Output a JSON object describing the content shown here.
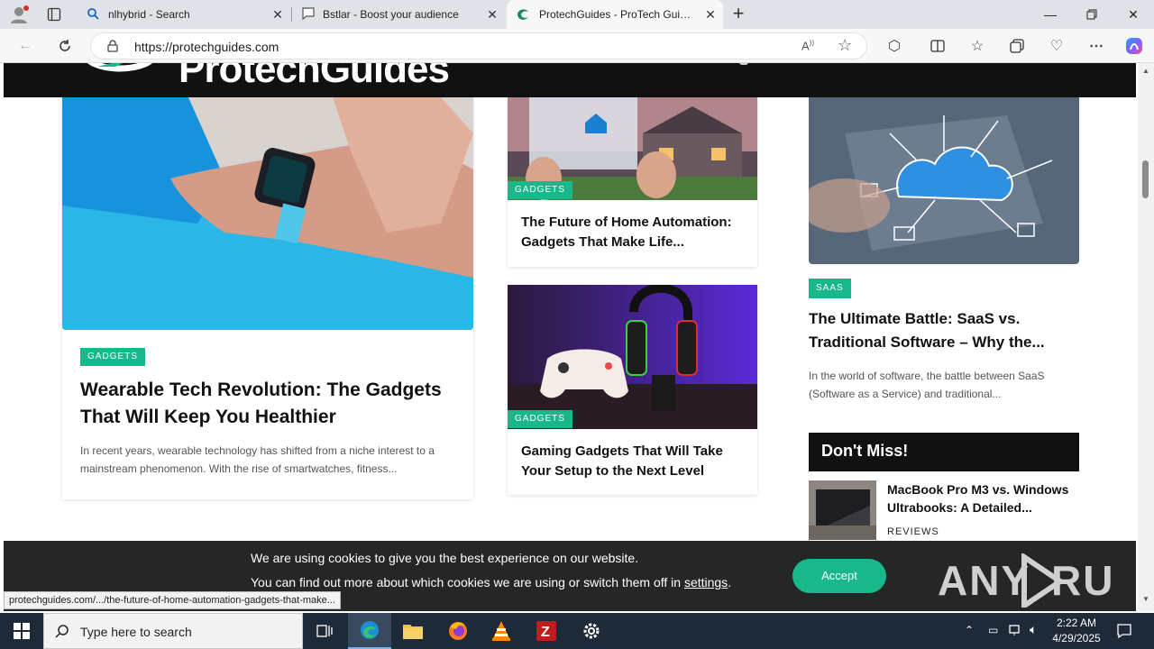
{
  "browser": {
    "tabs": [
      {
        "title": "nlhybrid - Search",
        "icon": "search-icon"
      },
      {
        "title": "Bstlar - Boost your audience",
        "icon": "chat-bubble-icon"
      },
      {
        "title": "ProtechGuides - ProTech Guides:",
        "icon": "edge-tab-icon"
      }
    ],
    "new_tab": "+",
    "url": "https://protechguides.com",
    "window_controls": [
      "minimize",
      "restore",
      "close"
    ]
  },
  "site": {
    "logo_text": "ProtechGuides"
  },
  "articles": {
    "wearable": {
      "category": "GADGETS",
      "title": "Wearable Tech Revolution: The Gadgets That Will Keep You Healthier",
      "excerpt": "In recent years, wearable technology has shifted from a niche interest to a mainstream phenomenon. With the rise of smartwatches, fitness..."
    },
    "home_automation": {
      "category": "GADGETS",
      "title": "The Future of Home Automation: Gadgets That Make Life..."
    },
    "gaming": {
      "category": "GADGETS",
      "title": "Gaming Gadgets That Will Take Your Setup to the Next Level"
    },
    "saas": {
      "category": "SAAS",
      "title": "The Ultimate Battle: SaaS vs. Traditional Software – Why the...",
      "excerpt": "In the world of software, the battle between SaaS (Software as a Service) and traditional..."
    }
  },
  "dont_miss": {
    "heading": "Don't Miss!",
    "items": [
      {
        "title": "MacBook Pro M3 vs. Windows Ultrabooks: A Detailed...",
        "category": "REVIEWS"
      }
    ]
  },
  "cookie": {
    "line1": "We are using cookies to give you the best experience on our website.",
    "line2_prefix": "You can find out more about which cookies we are using or switch them off in ",
    "line2_link": "settings",
    "line2_suffix": ".",
    "accept_label": "Accept"
  },
  "watermark": "ANY RUN",
  "status_url": "protechguides.com/.../the-future-of-home-automation-gadgets-that-make...",
  "taskbar": {
    "search_placeholder": "Type here to search",
    "time": "2:22 AM",
    "date": "4/29/2025"
  },
  "colors": {
    "accent": "#18b88a",
    "header_bg": "#111111",
    "taskbar_bg": "#1f2a38"
  }
}
